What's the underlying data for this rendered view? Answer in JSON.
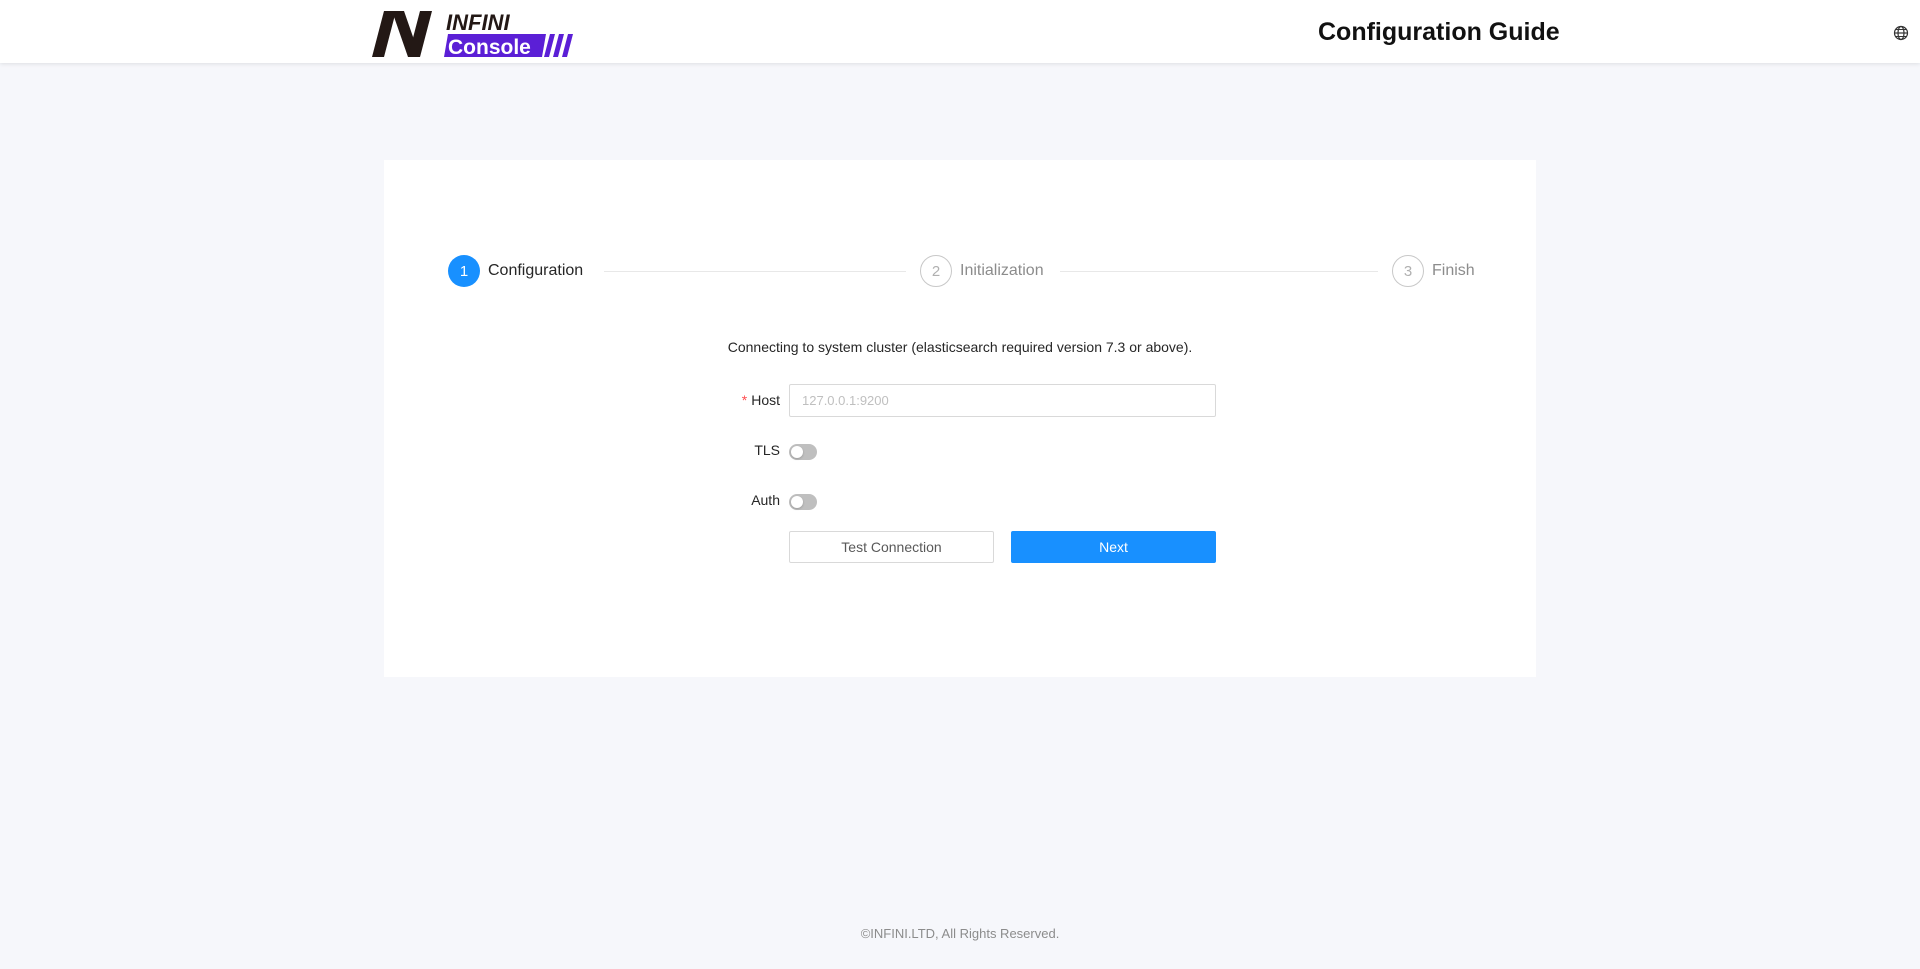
{
  "header": {
    "logo_word_top": "INFINI",
    "logo_word_bottom": "Console",
    "title": "Configuration Guide",
    "language_icon": "globe-icon"
  },
  "steps": [
    {
      "number": "1",
      "label": "Configuration",
      "status": "active"
    },
    {
      "number": "2",
      "label": "Initialization",
      "status": "waiting"
    },
    {
      "number": "3",
      "label": "Finish",
      "status": "waiting"
    }
  ],
  "form": {
    "intro": "Connecting to system cluster (elasticsearch required version 7.3 or above).",
    "host": {
      "required_mark": "*",
      "label": "Host",
      "placeholder": "127.0.0.1:9200",
      "value": ""
    },
    "tls": {
      "label": "TLS",
      "checked": false
    },
    "auth": {
      "label": "Auth",
      "checked": false
    },
    "test_button": "Test Connection",
    "next_button": "Next"
  },
  "footer": {
    "copyright": "©INFINI.LTD, All Rights Reserved."
  },
  "colors": {
    "primary": "#1890ff",
    "logo_purple": "#5b1fd6",
    "required": "#ff4d4f",
    "background": "#f6f7fb"
  }
}
